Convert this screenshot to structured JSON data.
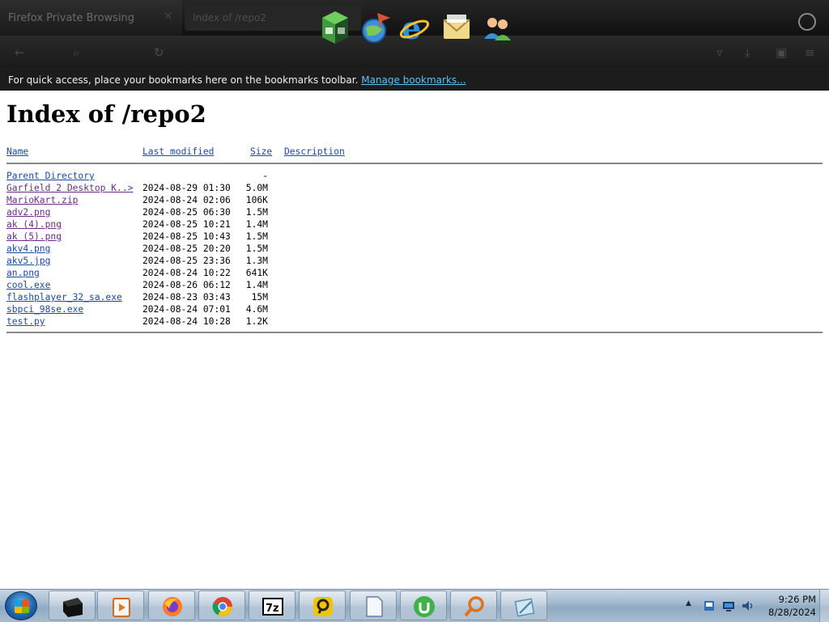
{
  "browser": {
    "tab_title": "Firefox Private Browsing",
    "url_placeholder": "Index of /repo2",
    "bookmarks_message": "For quick access, place your bookmarks here on the bookmarks toolbar.",
    "bookmarks_link": "Manage bookmarks..."
  },
  "page": {
    "title": "Index of /repo2",
    "columns": {
      "name": "Name",
      "modified": "Last modified",
      "size": "Size",
      "description": "Description"
    },
    "parent": {
      "name": "Parent Directory",
      "size": "-"
    },
    "files": [
      {
        "name": "Garfield 2 Desktop K..>",
        "modified": "2024-08-29 01:30",
        "size": "5.0M"
      },
      {
        "name": "MarioKart.zip",
        "modified": "2024-08-24 02:06",
        "size": "106K"
      },
      {
        "name": "adv2.png",
        "modified": "2024-08-25 06:30",
        "size": "1.5M"
      },
      {
        "name": "ak (4).png",
        "modified": "2024-08-25 10:21",
        "size": "1.4M"
      },
      {
        "name": "ak (5).png",
        "modified": "2024-08-25 10:43",
        "size": "1.5M"
      },
      {
        "name": "akv4.png",
        "modified": "2024-08-25 20:20",
        "size": "1.5M"
      },
      {
        "name": "akv5.jpg",
        "modified": "2024-08-25 23:36",
        "size": "1.3M"
      },
      {
        "name": "an.png",
        "modified": "2024-08-24 10:22",
        "size": "641K"
      },
      {
        "name": "cool.exe",
        "modified": "2024-08-26 06:12",
        "size": "1.4M"
      },
      {
        "name": "flashplayer_32_sa.exe",
        "modified": "2024-08-23 03:43",
        "size": "15M"
      },
      {
        "name": "sbpci_98se.exe",
        "modified": "2024-08-24 07:01",
        "size": "4.6M"
      },
      {
        "name": "test.py",
        "modified": "2024-08-24 10:28",
        "size": "1.2K"
      }
    ]
  },
  "dock": {
    "icons": [
      "spreadsheet-cube-icon",
      "globe-arrow-icon",
      "internet-explorer-icon",
      "mail-envelope-icon",
      "users-icon"
    ]
  },
  "taskbar": {
    "items": [
      "terminal-icon",
      "media-player-icon",
      "firefox-icon",
      "chrome-icon",
      "7zip-icon",
      "remote-desktop-icon",
      "notepad-icon",
      "utorrent-icon",
      "search-magnifier-icon",
      "paint-icon"
    ],
    "time": "9:26 PM",
    "date": "8/28/2024"
  }
}
